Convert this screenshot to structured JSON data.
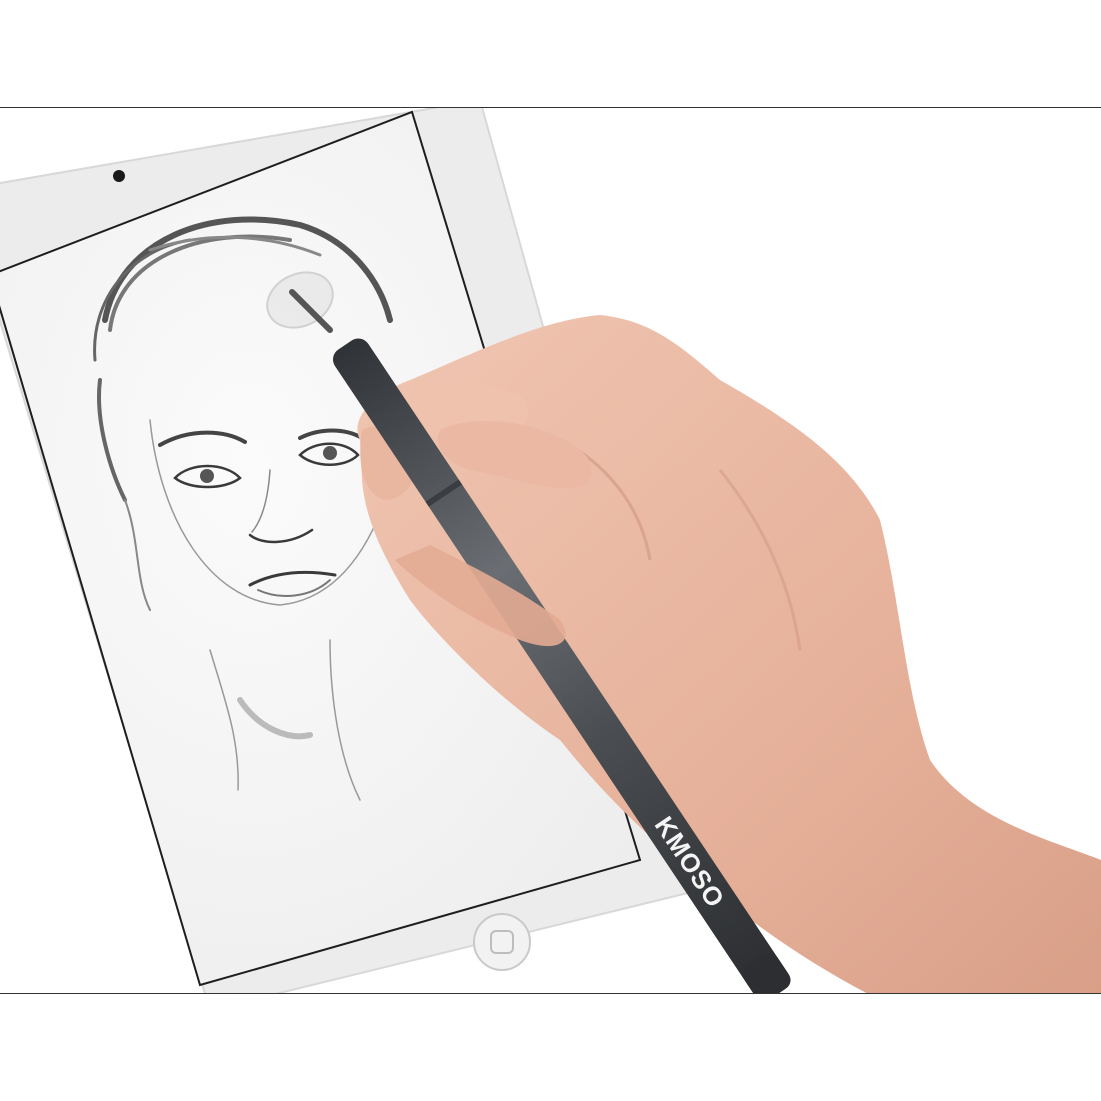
{
  "photo": {
    "subject": "stylus-pen-drawing-on-tablet",
    "pen_brand": "KMOSO",
    "colors": {
      "background": "#ffffff",
      "tablet_frame": "#ececec",
      "screen": "#f6f6f6",
      "pen_body": "#4b4e52",
      "skin": "#e9b9a3"
    }
  }
}
